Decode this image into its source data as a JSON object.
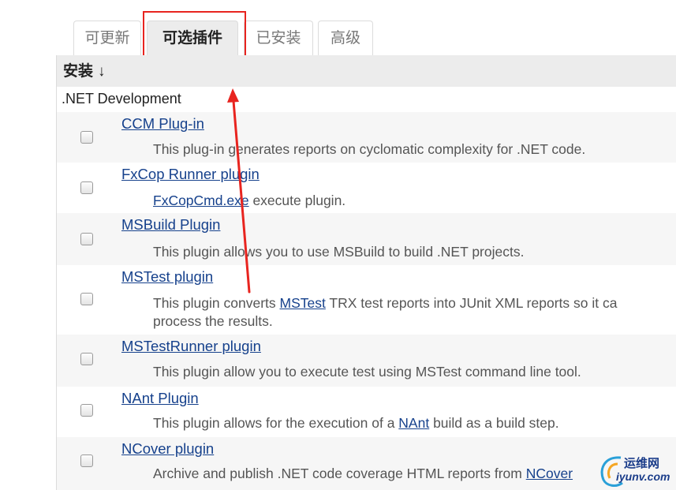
{
  "tabs": [
    {
      "label": "可更新",
      "active": false
    },
    {
      "label": "可选插件",
      "active": true
    },
    {
      "label": "已安装",
      "active": false
    },
    {
      "label": "高级",
      "active": false
    }
  ],
  "table": {
    "header_label": "安装",
    "sort_arrow": "↓",
    "category": ".NET Development"
  },
  "plugins": [
    {
      "name": "CCM Plug-in",
      "desc": "This plug-in generates reports on cyclomatic complexity for .NET code."
    },
    {
      "name": "FxCop Runner plugin",
      "desc_link": "FxCopCmd.exe",
      "desc_after": " execute plugin."
    },
    {
      "name": "MSBuild Plugin",
      "desc": "This plugin allows you to use MSBuild to build .NET projects."
    },
    {
      "name": "MSTest plugin",
      "desc_before": "This plugin converts ",
      "desc_link": "MSTest",
      "desc_after": " TRX test reports into JUnit XML reports so it ca",
      "desc_line2": "process the results."
    },
    {
      "name": "MSTestRunner plugin",
      "desc": "This plugin allow you to execute test using MSTest command line tool."
    },
    {
      "name": "NAnt Plugin",
      "desc_before": "This plugin allows for the execution of a ",
      "desc_link": "NAnt",
      "desc_after": " build as a build step."
    },
    {
      "name": "NCover plugin",
      "desc_before": "Archive and publish .NET code coverage HTML reports from ",
      "desc_link": "NCover"
    }
  ],
  "watermark": {
    "line1": "运维网",
    "line2": "iyunv.com"
  },
  "colors": {
    "link": "#16418c",
    "annotation": "#e8241f",
    "active_tab_bg": "#ececec"
  }
}
